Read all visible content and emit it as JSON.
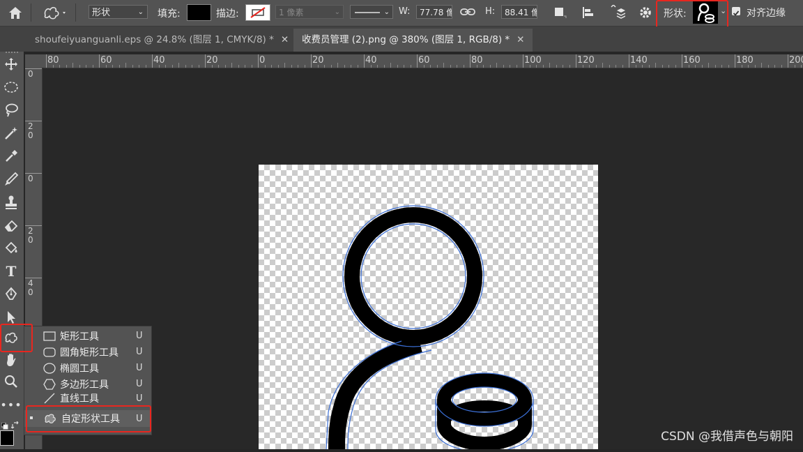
{
  "options_bar": {
    "mode_value": "形状",
    "fill_label": "填充:",
    "stroke_label": "描边:",
    "stroke_width_value": "1 像素",
    "width_label": "W:",
    "width_value": "77.78 像",
    "height_label": "H:",
    "height_value": "88.41 像",
    "shape_label": "形状:",
    "align_edges_label": "对齐边缘"
  },
  "tabs": [
    {
      "label": "shoufeiyuanguanli.eps @ 24.8% (图层 1, CMYK/8) *",
      "close": "✕"
    },
    {
      "label": "收费员管理 (2).png @ 380% (图层 1, RGB/8) *",
      "close": "✕"
    }
  ],
  "ruler": {
    "h_ticks": [
      "80",
      "60",
      "40",
      "20",
      "0",
      "20",
      "40",
      "60",
      "80",
      "100",
      "120",
      "140",
      "160",
      "180",
      "200"
    ],
    "v_ticks": [
      "0",
      "2\n0",
      "0",
      "2\n0",
      "4\n0"
    ]
  },
  "flyout": {
    "items": [
      {
        "label": "矩形工具",
        "key": "U"
      },
      {
        "label": "圆角矩形工具",
        "key": "U"
      },
      {
        "label": "椭圆工具",
        "key": "U"
      },
      {
        "label": "多边形工具",
        "key": "U"
      },
      {
        "label": "直线工具",
        "key": "U"
      },
      {
        "label": "自定形状工具",
        "key": "U"
      }
    ]
  },
  "watermark": "CSDN @我借声色与朝阳",
  "colors": {
    "highlight": "#e8261f",
    "panel": "#535353",
    "canvas": "#282828"
  }
}
